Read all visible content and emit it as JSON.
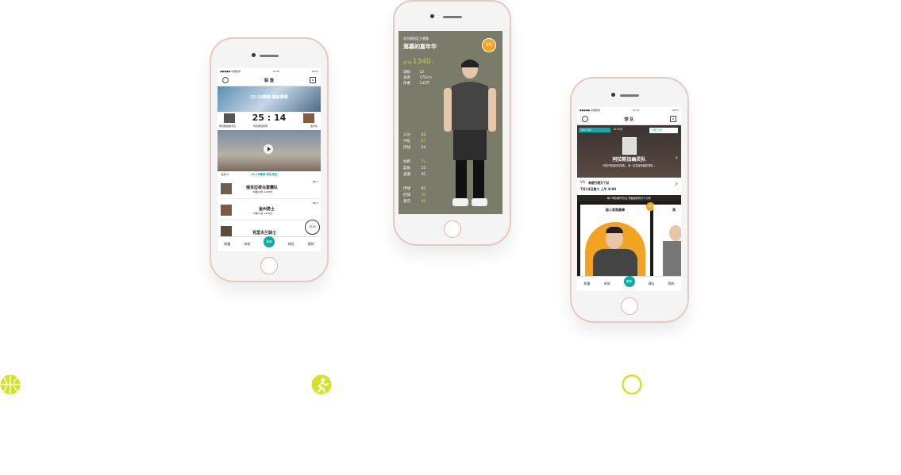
{
  "phone1": {
    "status": {
      "carrier": "●●●●● 中国联通",
      "time": "12:35",
      "battery": "100%"
    },
    "title": "联 盟",
    "banner_text": "25-16赛季 精彩赛事",
    "score": "25 : 14",
    "team_left": "阿拉斯加幽灵队",
    "match_label": "年终赛冠军赛",
    "team_right": "金州队",
    "region": "北京 ▾",
    "season": "15-16赛季 球队排名",
    "ranks": [
      {
        "no": "NO.1",
        "name": "俄克拉荷马雷霆队",
        "detail": "39胜24负 1436分"
      },
      {
        "no": "NO.2",
        "name": "金州勇士",
        "detail": "73胜10负 1436分"
      },
      {
        "no": "",
        "name": "克里夫兰骑士",
        "detail": ""
      }
    ],
    "fab_value": "1545",
    "tabs": [
      "联盟",
      "市场",
      "赛事",
      "球队",
      "我的"
    ]
  },
  "phone2": {
    "location": "北京朝阳区大望路",
    "player_title": "落幕的嘉年华",
    "badge": "SG",
    "power_label": "能力值",
    "power_value": "1340",
    "power_unit": "G",
    "info": [
      {
        "label": "球龄",
        "value": "12"
      },
      {
        "label": "身高",
        "value": "175cm"
      },
      {
        "label": "体重",
        "value": "132斤"
      }
    ],
    "stats1": [
      {
        "label": "三分",
        "value": "23"
      },
      {
        "label": "中投",
        "value": "87"
      },
      {
        "label": "内线",
        "value": "24"
      }
    ],
    "stats2": [
      {
        "label": "抢断",
        "value": "75"
      },
      {
        "label": "篮板",
        "value": "15"
      },
      {
        "label": "盖帽",
        "value": "45"
      }
    ],
    "stats3": [
      {
        "label": "传球",
        "value": "65"
      },
      {
        "label": "控球",
        "value": "76"
      },
      {
        "label": "意识",
        "value": "88"
      }
    ],
    "accent": "#c9d24a"
  },
  "phone3": {
    "status": {
      "carrier": "●●●●● 中国联通",
      "time": "12:32",
      "battery": "100%"
    },
    "title": "球 队",
    "rank_label": "NO.101",
    "points_label": "1432分",
    "record_label": "1胜35负",
    "team_name": "阿拉斯加幽灵队",
    "team_desc": "可能不是最好的球队，但一定是最有趣的球队...",
    "vs_label": "VS",
    "vs_team": "有硬打硬天下队",
    "vs_time": "7月14日周六 上午 8:00",
    "banner_text": "每个球队都可在此 预留最新的什么分享",
    "card_title": "敌人我我最棒",
    "card_title2": "我",
    "badge": "SG",
    "tabs": [
      "联盟",
      "市场",
      "赛事",
      "球队",
      "我的"
    ]
  },
  "colors": {
    "teal": "#13a9a5",
    "lime": "#d6e227",
    "olive": "#7c7c6a",
    "orange": "#f0a422"
  }
}
